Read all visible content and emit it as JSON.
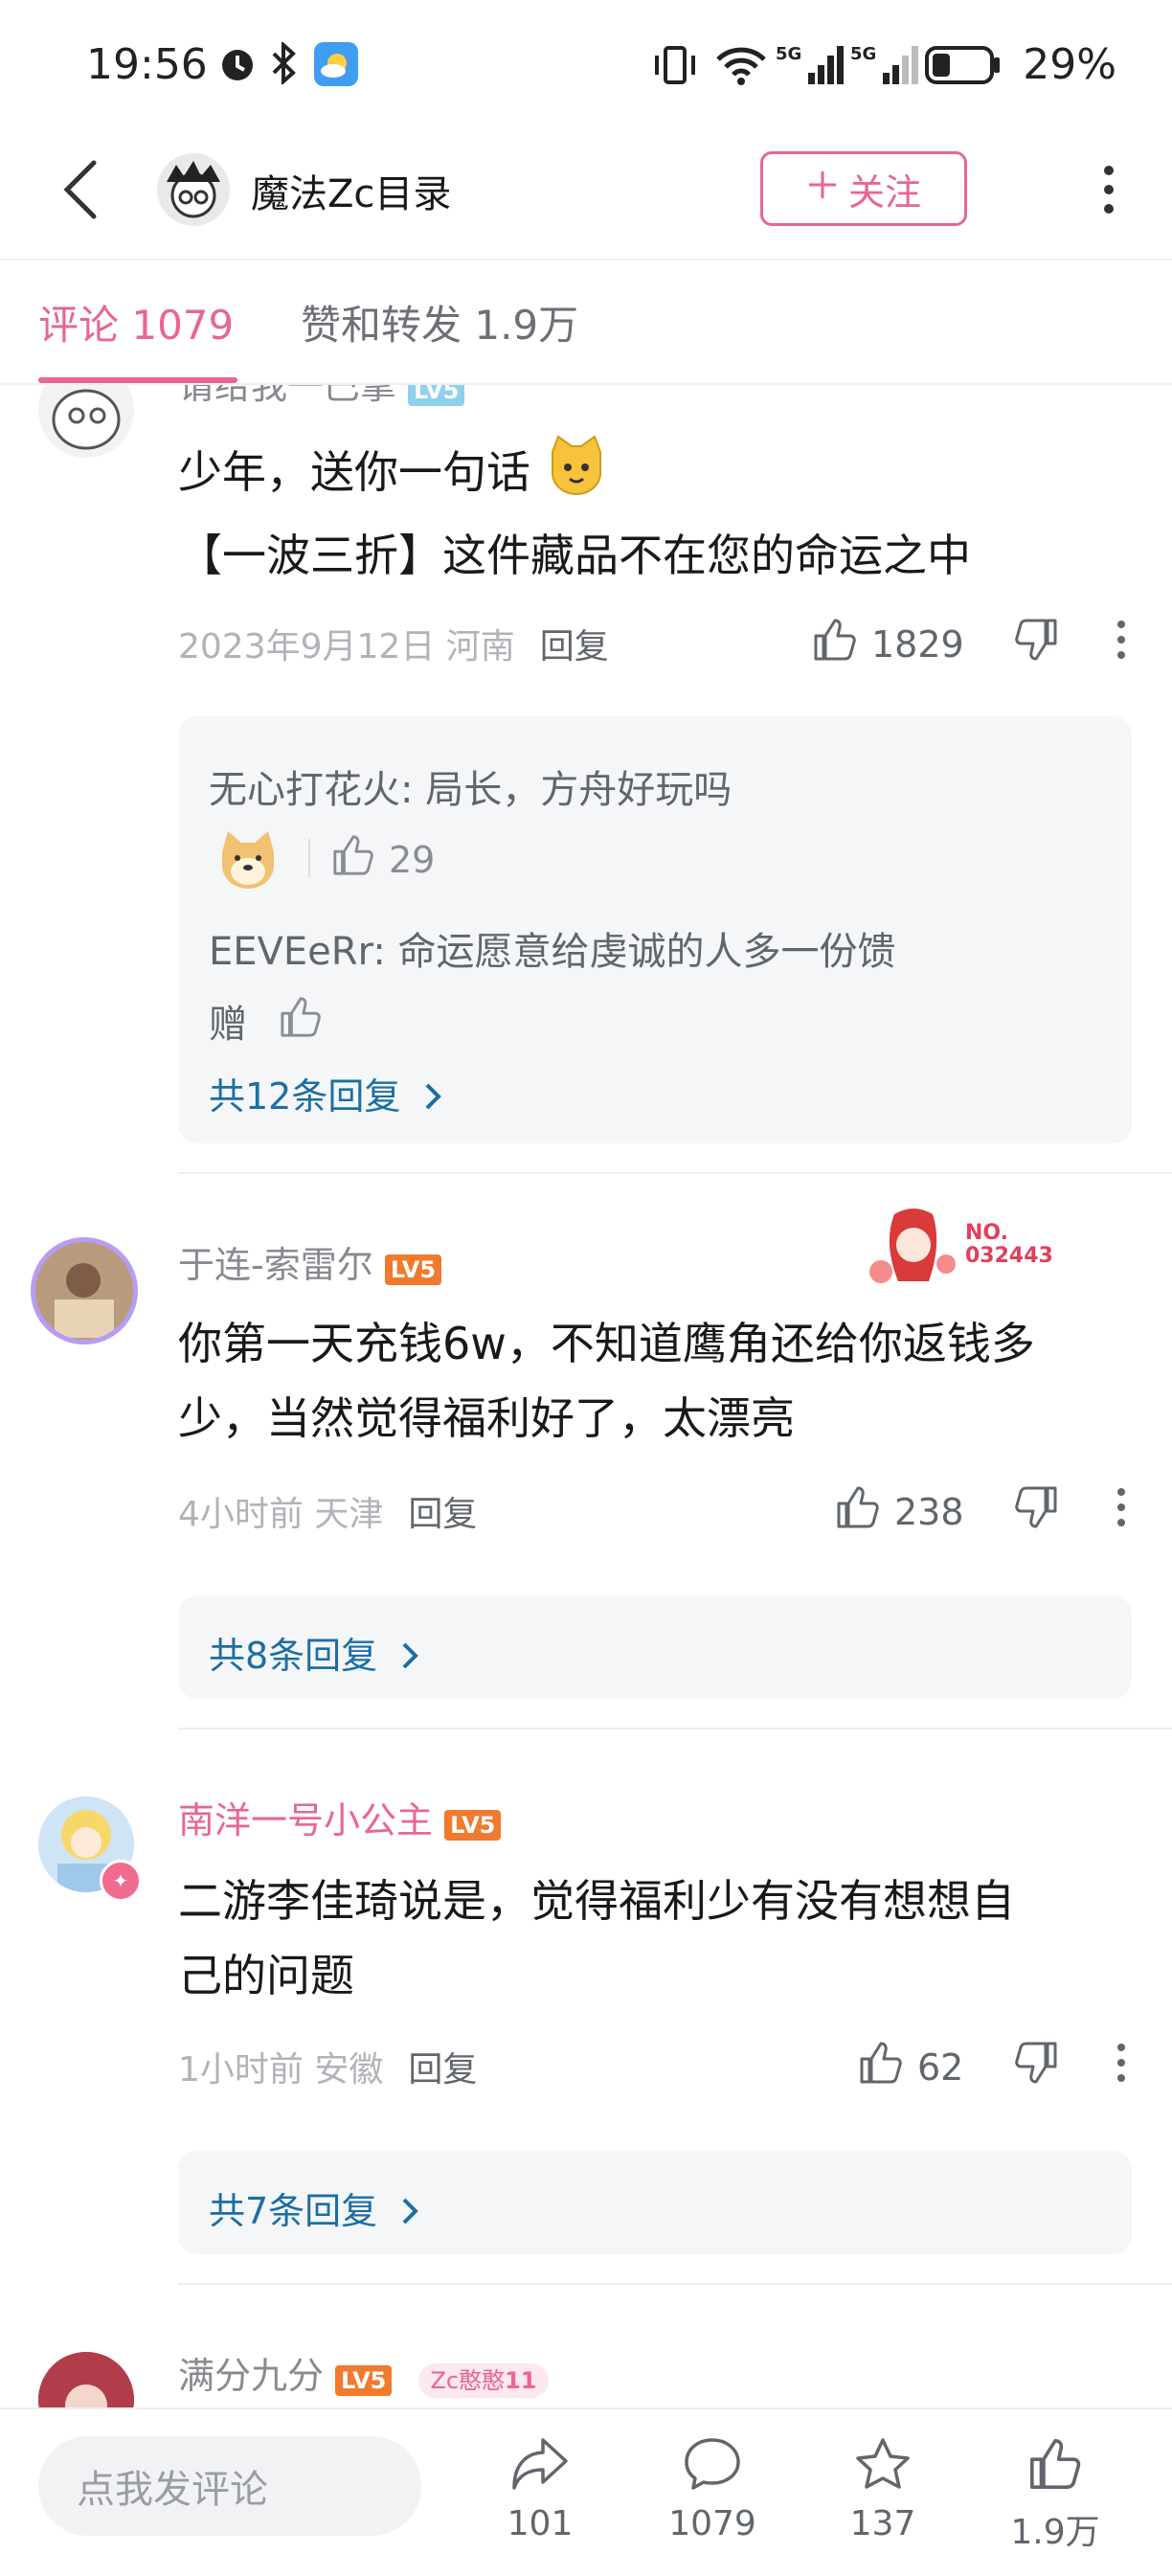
{
  "status_bar": {
    "time": "19:56",
    "battery": "29%"
  },
  "header": {
    "title": "魔法Zc目录",
    "follow_label": "关注"
  },
  "tabs": [
    {
      "label": "评论 1079"
    },
    {
      "label": "赞和转发 1.9万"
    }
  ],
  "comments": [
    {
      "author": "请给我一巴掌",
      "level": "LV5",
      "text_lines": [
        "少年，送你一句话",
        "【一波三折】这件藏品不在您的命运之中"
      ],
      "meta": "2023年9月12日 河南",
      "reply_label": "回复",
      "likes": "1829",
      "replies": [
        {
          "text": "无心打花火: 局长，方舟好玩吗",
          "likes": "29"
        },
        {
          "text_lines": [
            "EEVEeRr: 命运愿意给虔诚的人多一份馈",
            "赠"
          ]
        }
      ],
      "more_replies": "共12条回复"
    },
    {
      "author": "于连-索雷尔",
      "level": "LV5",
      "badge_no": "NO.\n032443",
      "text_lines": [
        "你第一天充钱6w，不知道鹰角还给你返钱多",
        "少，当然觉得福利好了，太漂亮"
      ],
      "meta": "4小时前 天津",
      "reply_label": "回复",
      "likes": "238",
      "more_replies": "共8条回复"
    },
    {
      "author": "南洋一号小公主",
      "level": "LV5",
      "text_lines": [
        "二游李佳琦说是，觉得福利少有没有想想自",
        "己的问题"
      ],
      "meta": "1小时前 安徽",
      "reply_label": "回复",
      "likes": "62",
      "more_replies": "共7条回复"
    },
    {
      "author": "满分九分",
      "level": "LV5",
      "fan_badge": "Zc憨憨",
      "fan_level": "11"
    }
  ],
  "bottom_bar": {
    "input_placeholder": "点我发评论",
    "share_count": "101",
    "comment_count": "1079",
    "star_count": "137",
    "like_count": "1.9万"
  }
}
